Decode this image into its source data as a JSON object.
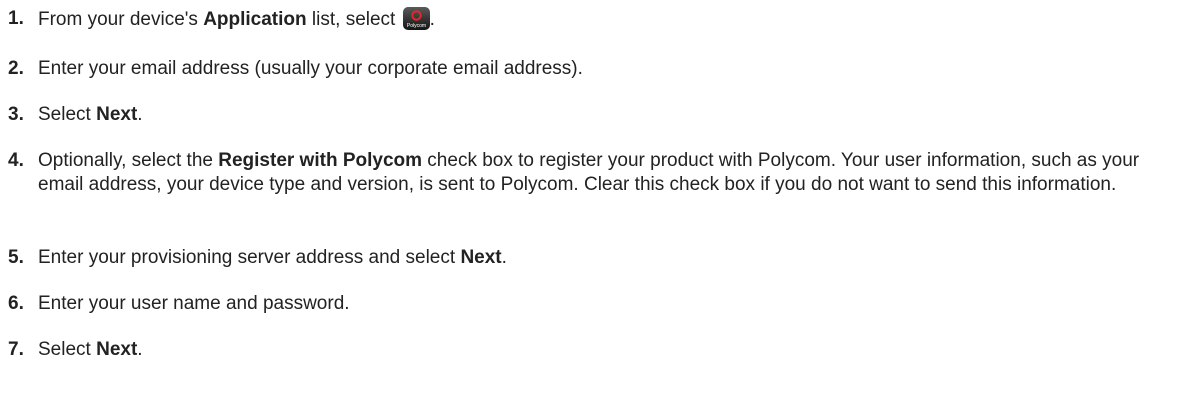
{
  "steps": [
    {
      "number": "1.",
      "parts": [
        {
          "text": "From your device's "
        },
        {
          "text": "Application",
          "bold": true
        },
        {
          "text": " list, select "
        },
        {
          "icon": "polycom-app-icon",
          "icon_text": "Polycom"
        },
        {
          "text": "."
        }
      ]
    },
    {
      "number": "2.",
      "parts": [
        {
          "text": "Enter your email address (usually your corporate email address)."
        }
      ]
    },
    {
      "number": "3.",
      "parts": [
        {
          "text": "Select "
        },
        {
          "text": "Next",
          "bold": true
        },
        {
          "text": "."
        }
      ]
    },
    {
      "number": "4.",
      "parts": [
        {
          "text": "Optionally, select the "
        },
        {
          "text": "Register with Polycom",
          "bold": true
        },
        {
          "text": " check box to register your product with Polycom. Your user information, such as your email address, your device type and version, is sent to Polycom. Clear this check box if you do not want to send this information."
        }
      ]
    },
    {
      "number": "5.",
      "parts": [
        {
          "text": "Enter your provisioning server address and select "
        },
        {
          "text": "Next",
          "bold": true
        },
        {
          "text": "."
        }
      ]
    },
    {
      "number": "6.",
      "parts": [
        {
          "text": "Enter your user name and password."
        }
      ]
    },
    {
      "number": "7.",
      "parts": [
        {
          "text": "Select "
        },
        {
          "text": "Next",
          "bold": true
        },
        {
          "text": "."
        }
      ]
    }
  ],
  "colors": {
    "text": "#222222",
    "icon_ring": "#e02a2a",
    "icon_bg": "#1a1a1a"
  }
}
